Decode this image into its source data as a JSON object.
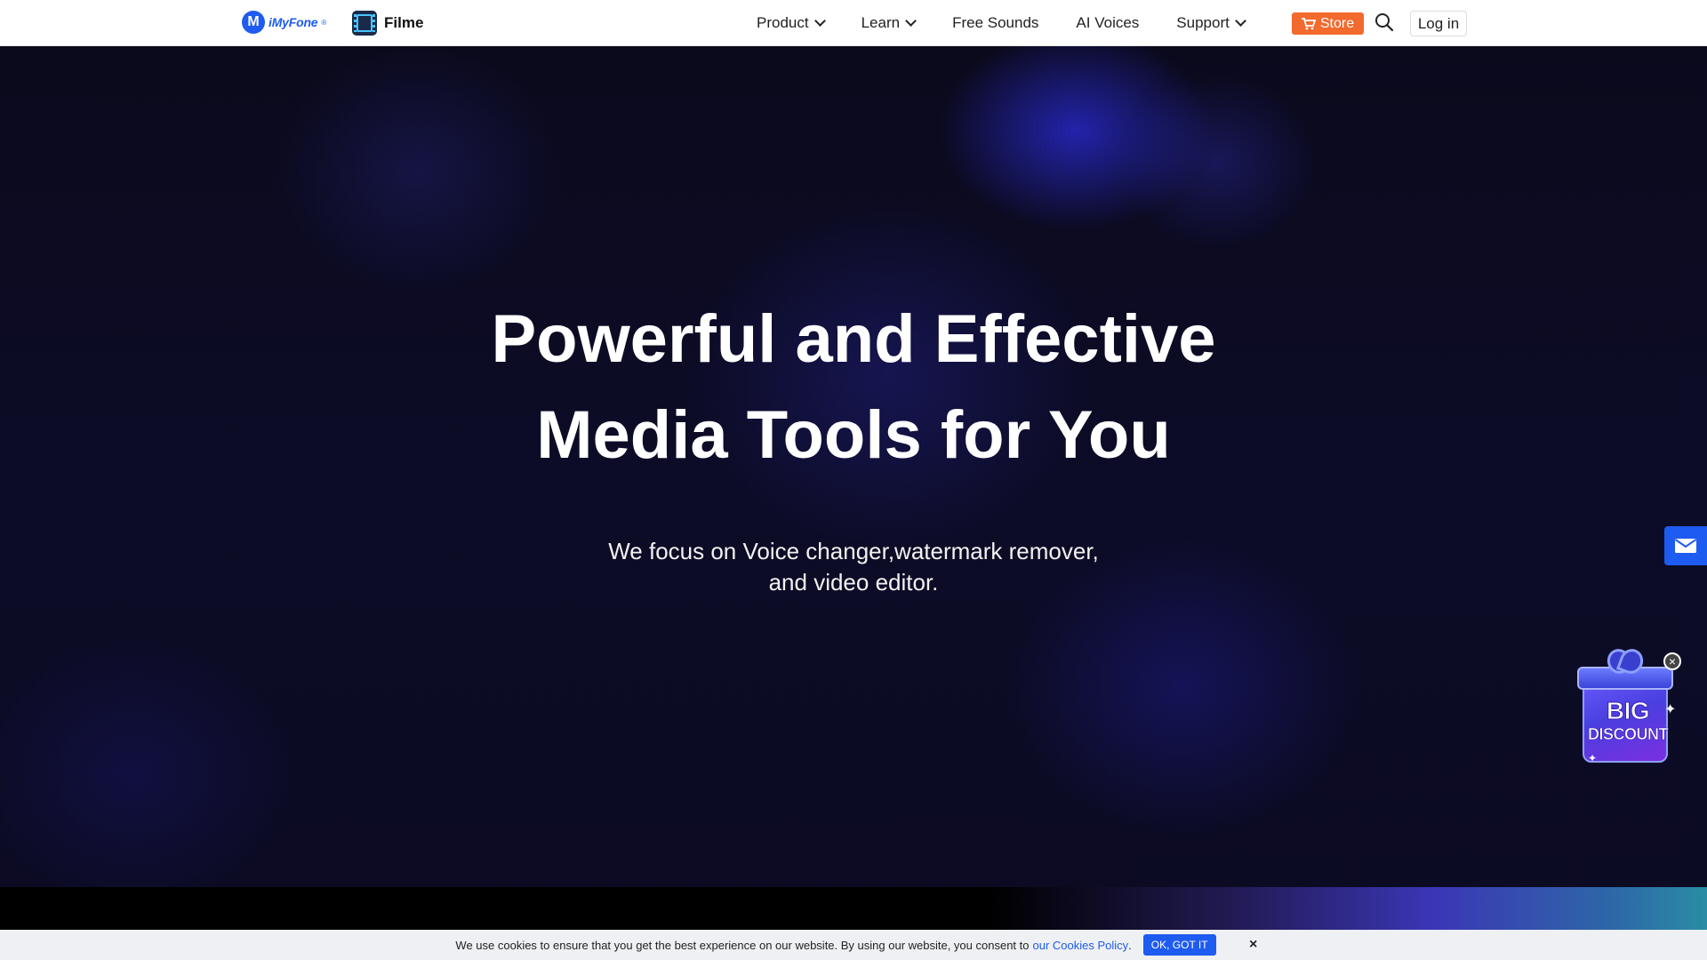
{
  "header": {
    "brand": {
      "logo_letter": "M",
      "name": "iMyFone",
      "reg": "®"
    },
    "product": {
      "name": "Filme",
      "icon": "film-icon"
    },
    "nav": [
      {
        "label": "Product",
        "has_dropdown": true
      },
      {
        "label": "Learn",
        "has_dropdown": true
      },
      {
        "label": "Free Sounds",
        "has_dropdown": false
      },
      {
        "label": "AI Voices",
        "has_dropdown": false
      },
      {
        "label": "Support",
        "has_dropdown": true
      }
    ],
    "store_label": "Store",
    "login_label": "Log in",
    "search_icon": "search-icon",
    "cart_icon": "cart-icon"
  },
  "hero": {
    "title_line1": "Powerful and Effective",
    "title_line2": "Media Tools for You",
    "subtitle_line1": "We focus on Voice changer,watermark remover,",
    "subtitle_line2": "and video editor."
  },
  "promo": {
    "line1": "BIG",
    "line2": "DISCOUNT",
    "close_icon": "close-icon"
  },
  "contact": {
    "icon": "mail-icon"
  },
  "cookie": {
    "text": "We use cookies to ensure that you get the best experience on our website. By using our website, you consent to",
    "link": "our Cookies Policy",
    "punct": ".",
    "ok_label": "OK, GOT IT",
    "close": "×"
  },
  "colors": {
    "accent": "#1e5bf0",
    "store": "#f26a2e",
    "hero_bg": "#0c0b24"
  }
}
